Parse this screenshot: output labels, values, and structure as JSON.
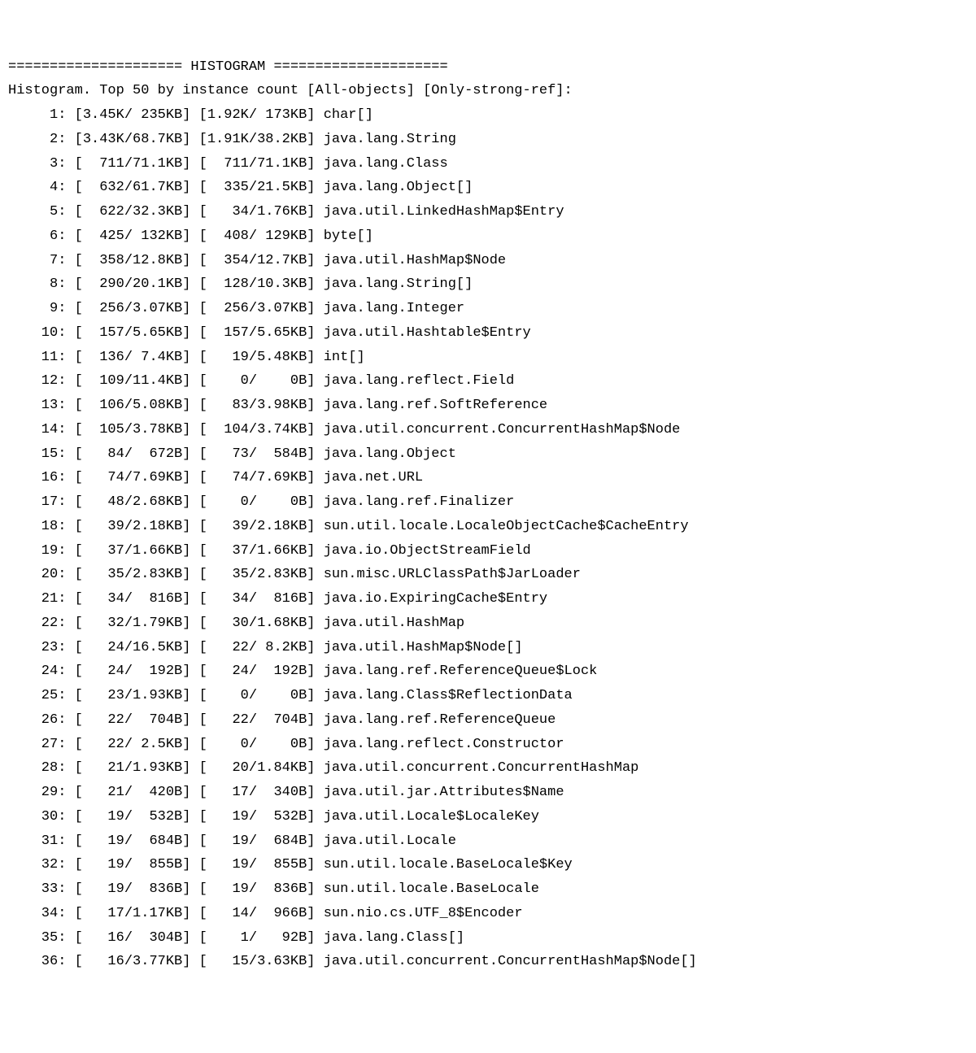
{
  "header_line": "===================== HISTOGRAM =====================",
  "subheader": "Histogram. Top 50 by instance count [All-objects] [Only-strong-ref]:",
  "rows": [
    {
      "n": 1,
      "all_count": "3.45K",
      "all_size": " 235KB",
      "strong_count": "1.92K",
      "strong_size": " 173KB",
      "class": "char[]"
    },
    {
      "n": 2,
      "all_count": "3.43K",
      "all_size": "68.7KB",
      "strong_count": "1.91K",
      "strong_size": "38.2KB",
      "class": "java.lang.String"
    },
    {
      "n": 3,
      "all_count": "  711",
      "all_size": "71.1KB",
      "strong_count": "  711",
      "strong_size": "71.1KB",
      "class": "java.lang.Class"
    },
    {
      "n": 4,
      "all_count": "  632",
      "all_size": "61.7KB",
      "strong_count": "  335",
      "strong_size": "21.5KB",
      "class": "java.lang.Object[]"
    },
    {
      "n": 5,
      "all_count": "  622",
      "all_size": "32.3KB",
      "strong_count": "   34",
      "strong_size": "1.76KB",
      "class": "java.util.LinkedHashMap$Entry"
    },
    {
      "n": 6,
      "all_count": "  425",
      "all_size": " 132KB",
      "strong_count": "  408",
      "strong_size": " 129KB",
      "class": "byte[]"
    },
    {
      "n": 7,
      "all_count": "  358",
      "all_size": "12.8KB",
      "strong_count": "  354",
      "strong_size": "12.7KB",
      "class": "java.util.HashMap$Node"
    },
    {
      "n": 8,
      "all_count": "  290",
      "all_size": "20.1KB",
      "strong_count": "  128",
      "strong_size": "10.3KB",
      "class": "java.lang.String[]"
    },
    {
      "n": 9,
      "all_count": "  256",
      "all_size": "3.07KB",
      "strong_count": "  256",
      "strong_size": "3.07KB",
      "class": "java.lang.Integer"
    },
    {
      "n": 10,
      "all_count": "  157",
      "all_size": "5.65KB",
      "strong_count": "  157",
      "strong_size": "5.65KB",
      "class": "java.util.Hashtable$Entry"
    },
    {
      "n": 11,
      "all_count": "  136",
      "all_size": " 7.4KB",
      "strong_count": "   19",
      "strong_size": "5.48KB",
      "class": "int[]"
    },
    {
      "n": 12,
      "all_count": "  109",
      "all_size": "11.4KB",
      "strong_count": "    0",
      "strong_size": "    0B",
      "class": "java.lang.reflect.Field"
    },
    {
      "n": 13,
      "all_count": "  106",
      "all_size": "5.08KB",
      "strong_count": "   83",
      "strong_size": "3.98KB",
      "class": "java.lang.ref.SoftReference"
    },
    {
      "n": 14,
      "all_count": "  105",
      "all_size": "3.78KB",
      "strong_count": "  104",
      "strong_size": "3.74KB",
      "class": "java.util.concurrent.ConcurrentHashMap$Node"
    },
    {
      "n": 15,
      "all_count": "   84",
      "all_size": "  672B",
      "strong_count": "   73",
      "strong_size": "  584B",
      "class": "java.lang.Object"
    },
    {
      "n": 16,
      "all_count": "   74",
      "all_size": "7.69KB",
      "strong_count": "   74",
      "strong_size": "7.69KB",
      "class": "java.net.URL"
    },
    {
      "n": 17,
      "all_count": "   48",
      "all_size": "2.68KB",
      "strong_count": "    0",
      "strong_size": "    0B",
      "class": "java.lang.ref.Finalizer"
    },
    {
      "n": 18,
      "all_count": "   39",
      "all_size": "2.18KB",
      "strong_count": "   39",
      "strong_size": "2.18KB",
      "class": "sun.util.locale.LocaleObjectCache$CacheEntry"
    },
    {
      "n": 19,
      "all_count": "   37",
      "all_size": "1.66KB",
      "strong_count": "   37",
      "strong_size": "1.66KB",
      "class": "java.io.ObjectStreamField"
    },
    {
      "n": 20,
      "all_count": "   35",
      "all_size": "2.83KB",
      "strong_count": "   35",
      "strong_size": "2.83KB",
      "class": "sun.misc.URLClassPath$JarLoader"
    },
    {
      "n": 21,
      "all_count": "   34",
      "all_size": "  816B",
      "strong_count": "   34",
      "strong_size": "  816B",
      "class": "java.io.ExpiringCache$Entry"
    },
    {
      "n": 22,
      "all_count": "   32",
      "all_size": "1.79KB",
      "strong_count": "   30",
      "strong_size": "1.68KB",
      "class": "java.util.HashMap"
    },
    {
      "n": 23,
      "all_count": "   24",
      "all_size": "16.5KB",
      "strong_count": "   22",
      "strong_size": " 8.2KB",
      "class": "java.util.HashMap$Node[]"
    },
    {
      "n": 24,
      "all_count": "   24",
      "all_size": "  192B",
      "strong_count": "   24",
      "strong_size": "  192B",
      "class": "java.lang.ref.ReferenceQueue$Lock"
    },
    {
      "n": 25,
      "all_count": "   23",
      "all_size": "1.93KB",
      "strong_count": "    0",
      "strong_size": "    0B",
      "class": "java.lang.Class$ReflectionData"
    },
    {
      "n": 26,
      "all_count": "   22",
      "all_size": "  704B",
      "strong_count": "   22",
      "strong_size": "  704B",
      "class": "java.lang.ref.ReferenceQueue"
    },
    {
      "n": 27,
      "all_count": "   22",
      "all_size": " 2.5KB",
      "strong_count": "    0",
      "strong_size": "    0B",
      "class": "java.lang.reflect.Constructor"
    },
    {
      "n": 28,
      "all_count": "   21",
      "all_size": "1.93KB",
      "strong_count": "   20",
      "strong_size": "1.84KB",
      "class": "java.util.concurrent.ConcurrentHashMap"
    },
    {
      "n": 29,
      "all_count": "   21",
      "all_size": "  420B",
      "strong_count": "   17",
      "strong_size": "  340B",
      "class": "java.util.jar.Attributes$Name"
    },
    {
      "n": 30,
      "all_count": "   19",
      "all_size": "  532B",
      "strong_count": "   19",
      "strong_size": "  532B",
      "class": "java.util.Locale$LocaleKey"
    },
    {
      "n": 31,
      "all_count": "   19",
      "all_size": "  684B",
      "strong_count": "   19",
      "strong_size": "  684B",
      "class": "java.util.Locale"
    },
    {
      "n": 32,
      "all_count": "   19",
      "all_size": "  855B",
      "strong_count": "   19",
      "strong_size": "  855B",
      "class": "sun.util.locale.BaseLocale$Key"
    },
    {
      "n": 33,
      "all_count": "   19",
      "all_size": "  836B",
      "strong_count": "   19",
      "strong_size": "  836B",
      "class": "sun.util.locale.BaseLocale"
    },
    {
      "n": 34,
      "all_count": "   17",
      "all_size": "1.17KB",
      "strong_count": "   14",
      "strong_size": "  966B",
      "class": "sun.nio.cs.UTF_8$Encoder"
    },
    {
      "n": 35,
      "all_count": "   16",
      "all_size": "  304B",
      "strong_count": "    1",
      "strong_size": "   92B",
      "class": "java.lang.Class[]"
    },
    {
      "n": 36,
      "all_count": "   16",
      "all_size": "3.77KB",
      "strong_count": "   15",
      "strong_size": "3.63KB",
      "class": "java.util.concurrent.ConcurrentHashMap$Node[]"
    }
  ]
}
